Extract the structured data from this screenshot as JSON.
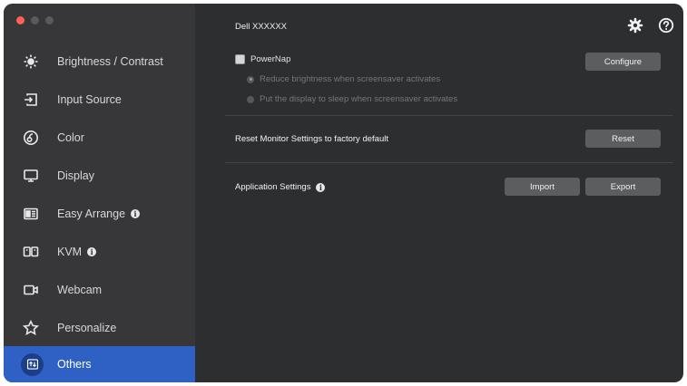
{
  "window": {
    "traffic_lights": [
      "#fe5f57",
      "#5a5a5c",
      "#5a5a5c"
    ]
  },
  "sidebar": {
    "items": [
      {
        "label": "Brightness / Contrast",
        "icon": "brightness-icon",
        "info": false,
        "active": false
      },
      {
        "label": "Input Source",
        "icon": "input-source-icon",
        "info": false,
        "active": false
      },
      {
        "label": "Color",
        "icon": "color-icon",
        "info": false,
        "active": false
      },
      {
        "label": "Display",
        "icon": "display-icon",
        "info": false,
        "active": false
      },
      {
        "label": "Easy Arrange",
        "icon": "easy-arrange-icon",
        "info": true,
        "active": false
      },
      {
        "label": "KVM",
        "icon": "kvm-icon",
        "info": true,
        "active": false
      },
      {
        "label": "Webcam",
        "icon": "webcam-icon",
        "info": false,
        "active": false
      },
      {
        "label": "Personalize",
        "icon": "star-icon",
        "info": false,
        "active": false
      },
      {
        "label": "Others",
        "icon": "others-icon",
        "info": false,
        "active": true
      }
    ],
    "accent": "#2f61c5"
  },
  "header": {
    "title": "Dell XXXXXX",
    "settings_icon": "gear-icon",
    "help_icon": "help-icon"
  },
  "powernap": {
    "label": "PowerNap",
    "checked": false,
    "option1": "Reduce brightness when screensaver activates",
    "option2": "Put the display to sleep when screensaver activates",
    "configure_label": "Configure"
  },
  "reset": {
    "label": "Reset Monitor Settings to factory default",
    "button_label": "Reset"
  },
  "app_settings": {
    "label": "Application Settings",
    "import_label": "Import",
    "export_label": "Export"
  }
}
